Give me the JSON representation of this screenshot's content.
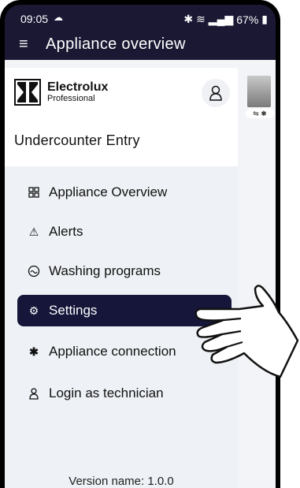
{
  "status_bar": {
    "time": "09:05",
    "battery": "67%"
  },
  "app_bar": {
    "title": "Appliance overview"
  },
  "brand": {
    "name": "Electrolux",
    "sub": "Professional"
  },
  "appliance": {
    "name": "Undercounter Entry"
  },
  "menu": [
    {
      "label": "Appliance Overview",
      "icon": "grid-icon",
      "active": false
    },
    {
      "label": "Alerts",
      "icon": "alert-triangle-icon",
      "active": false
    },
    {
      "label": "Washing programs",
      "icon": "wash-icon",
      "active": false
    },
    {
      "label": "Settings",
      "icon": "gear-icon",
      "active": true
    },
    {
      "label": "Appliance connection",
      "icon": "bluetooth-icon",
      "active": false
    },
    {
      "label": "Login as technician",
      "icon": "technician-icon",
      "active": false
    }
  ],
  "version": "Version name: 1.0.0",
  "colors": {
    "primary": "#15163a",
    "menu_bg": "#eef1f5"
  }
}
